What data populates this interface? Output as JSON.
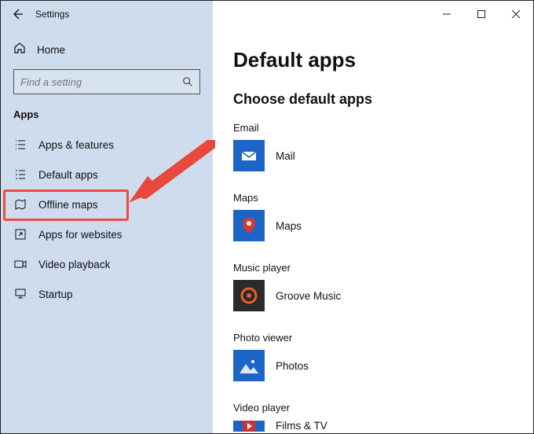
{
  "window": {
    "title": "Settings"
  },
  "sidebar": {
    "home": "Home",
    "search_placeholder": "Find a setting",
    "category": "Apps",
    "items": [
      {
        "label": "Apps & features"
      },
      {
        "label": "Default apps"
      },
      {
        "label": "Offline maps"
      },
      {
        "label": "Apps for websites"
      },
      {
        "label": "Video playback"
      },
      {
        "label": "Startup"
      }
    ]
  },
  "main": {
    "heading": "Default apps",
    "subheading": "Choose default apps",
    "defaults": [
      {
        "category": "Email",
        "app": "Mail"
      },
      {
        "category": "Maps",
        "app": "Maps"
      },
      {
        "category": "Music player",
        "app": "Groove Music"
      },
      {
        "category": "Photo viewer",
        "app": "Photos"
      },
      {
        "category": "Video player",
        "app": "Films & TV"
      }
    ]
  },
  "annotation": {
    "highlight_item_index": 1
  }
}
